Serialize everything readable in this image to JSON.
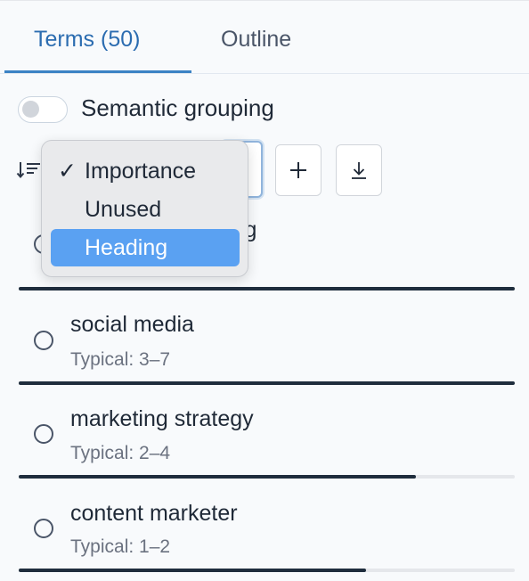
{
  "tabs": [
    {
      "label": "Terms (50)",
      "active": true
    },
    {
      "label": "Outline",
      "active": false
    }
  ],
  "semantic_grouping": {
    "label": "Semantic grouping",
    "enabled": false
  },
  "sort": {
    "options": [
      {
        "label": "Importance",
        "checked": true,
        "check_mark": "✓"
      },
      {
        "label": "Unused",
        "checked": false
      },
      {
        "label": "Heading",
        "checked": false,
        "highlighted": true
      }
    ]
  },
  "toolbar": {
    "add_icon": "plus-icon",
    "download_icon": "download-icon"
  },
  "terms": [
    {
      "name_tail": "ing",
      "typical": "",
      "progress": 1.0
    },
    {
      "name": "social media",
      "typical": "Typical: 3–7",
      "progress": 1.0
    },
    {
      "name": "marketing strategy",
      "typical": "Typical: 2–4",
      "progress": 0.8
    },
    {
      "name": "content marketer",
      "typical": "Typical: 1–2",
      "progress": 0.7
    }
  ],
  "colors": {
    "accent": "#2b6cb0",
    "highlight": "#5aa1f2",
    "bar": "#1f2d3d"
  }
}
